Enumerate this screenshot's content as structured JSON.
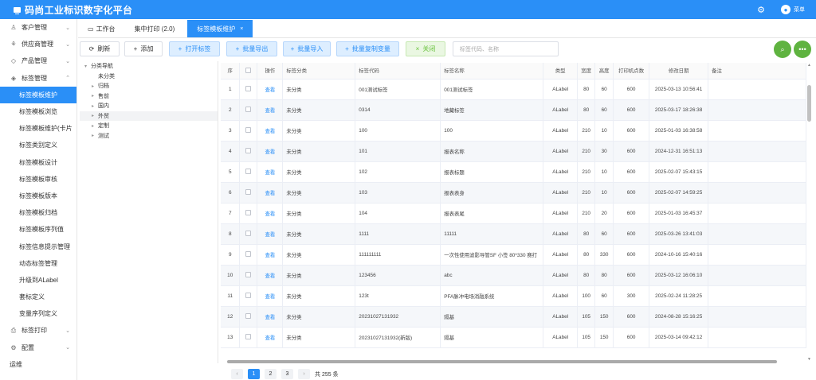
{
  "app": {
    "title": "码尚工业标识数字化平台",
    "user_label": "菜单"
  },
  "sidebar": {
    "items": [
      {
        "label": "客户管理",
        "kind": "group",
        "icon": "user-icon",
        "open": false
      },
      {
        "label": "供应商管理",
        "kind": "group",
        "icon": "supplier-icon",
        "open": false
      },
      {
        "label": "产品管理",
        "kind": "group",
        "icon": "product-icon",
        "open": false
      },
      {
        "label": "标签管理",
        "kind": "group",
        "icon": "label-icon",
        "open": true
      },
      {
        "label": "标签模板维护",
        "kind": "sub",
        "active": true
      },
      {
        "label": "标签模板浏览",
        "kind": "sub"
      },
      {
        "label": "标签模板维护(卡片",
        "kind": "sub"
      },
      {
        "label": "标签类别定义",
        "kind": "sub"
      },
      {
        "label": "标签模板设计",
        "kind": "sub"
      },
      {
        "label": "标签模板审核",
        "kind": "sub"
      },
      {
        "label": "标签模板版本",
        "kind": "sub"
      },
      {
        "label": "标签模板归档",
        "kind": "sub"
      },
      {
        "label": "标签模板序列值",
        "kind": "sub"
      },
      {
        "label": "标签信息提示管理",
        "kind": "sub"
      },
      {
        "label": "动态标签管理",
        "kind": "sub"
      },
      {
        "label": "升级到ALabel",
        "kind": "sub"
      },
      {
        "label": "套标定义",
        "kind": "sub"
      },
      {
        "label": "变量序列定义",
        "kind": "sub"
      },
      {
        "label": "标签打印",
        "kind": "group",
        "icon": "print-icon",
        "open": false
      },
      {
        "label": "配置",
        "kind": "group",
        "icon": "config-icon",
        "open": false
      },
      {
        "label": "运维",
        "kind": "plain"
      }
    ]
  },
  "tabs": {
    "workbench": "工作台",
    "print": "集中打印 (2.0)",
    "active": "标签模板维护"
  },
  "toolbar": {
    "refresh": "刷新",
    "add": "添加",
    "open": "打开标签",
    "export": "批量导出",
    "import": "批量导入",
    "copy": "批量复制变量",
    "close": "关闭",
    "search_placeholder": "标签代码、名称"
  },
  "tree": {
    "root": "分类导航",
    "items": [
      {
        "label": "未分类",
        "caret": false,
        "selected": false
      },
      {
        "label": "归档",
        "caret": true,
        "selected": false
      },
      {
        "label": "售前",
        "caret": true,
        "selected": false
      },
      {
        "label": "国内",
        "caret": true,
        "selected": false
      },
      {
        "label": "外贸",
        "caret": true,
        "selected": true
      },
      {
        "label": "定制",
        "caret": true,
        "selected": false
      },
      {
        "label": "测试",
        "caret": true,
        "selected": false
      }
    ]
  },
  "table": {
    "headers": [
      "序",
      "",
      "操作",
      "标签分类",
      "标签代码",
      "标签名称",
      "类型",
      "宽度",
      "高度",
      "打印机点数",
      "修改日期",
      "备注"
    ],
    "rows": [
      [
        "1",
        "",
        "查看",
        "未分类",
        "001测试标签",
        "001测试标签",
        "ALabel",
        "80",
        "60",
        "600",
        "2025-03-13 10:56:41",
        ""
      ],
      [
        "2",
        "",
        "查看",
        "未分类",
        "0314",
        "地藏标签",
        "ALabel",
        "80",
        "60",
        "600",
        "2025-03-17 18:26:38",
        ""
      ],
      [
        "3",
        "",
        "查看",
        "未分类",
        "100",
        "100",
        "ALabel",
        "210",
        "10",
        "600",
        "2025-01-03 16:38:58",
        ""
      ],
      [
        "4",
        "",
        "查看",
        "未分类",
        "101",
        "报表名称",
        "ALabel",
        "210",
        "30",
        "600",
        "2024-12-31 16:51:13",
        ""
      ],
      [
        "5",
        "",
        "查看",
        "未分类",
        "102",
        "报表标题",
        "ALabel",
        "210",
        "10",
        "600",
        "2025-02-07 15:43:15",
        ""
      ],
      [
        "6",
        "",
        "查看",
        "未分类",
        "103",
        "报表表身",
        "ALabel",
        "210",
        "10",
        "600",
        "2025-02-07 14:59:25",
        ""
      ],
      [
        "7",
        "",
        "查看",
        "未分类",
        "104",
        "报表表尾",
        "ALabel",
        "210",
        "20",
        "600",
        "2025-01-03 16:45:37",
        ""
      ],
      [
        "8",
        "",
        "查看",
        "未分类",
        "1111",
        "11111",
        "ALabel",
        "80",
        "60",
        "600",
        "2025-03-26 13:41:03",
        ""
      ],
      [
        "9",
        "",
        "查看",
        "未分类",
        "111111111",
        "一次性使用滤影导管SF 小签 80*330 赛打",
        "ALabel",
        "80",
        "330",
        "600",
        "2024-10-16 15:40:16",
        ""
      ],
      [
        "10",
        "",
        "查看",
        "未分类",
        "123456",
        "abc",
        "ALabel",
        "80",
        "80",
        "600",
        "2025-03-12 16:06:10",
        ""
      ],
      [
        "11",
        "",
        "查看",
        "未分类",
        "123t",
        "PFA脉冲电场消融系统",
        "ALabel",
        "100",
        "60",
        "300",
        "2025-02-24 11:28:25",
        ""
      ],
      [
        "12",
        "",
        "查看",
        "未分类",
        "20231027131932",
        "隔基",
        "ALabel",
        "105",
        "150",
        "600",
        "2024-08-28 15:16:25",
        ""
      ],
      [
        "13",
        "",
        "查看",
        "未分类",
        "20231027131932(新版)",
        "隔基",
        "ALabel",
        "105",
        "150",
        "600",
        "2025-03-14 09:42:12",
        ""
      ]
    ]
  },
  "pager": {
    "pages": [
      "1",
      "2",
      "3"
    ],
    "prev": "‹",
    "next": "›",
    "total": "共 255 条"
  },
  "colors": {
    "primary": "#2a8ff7",
    "success": "#5fb340"
  }
}
